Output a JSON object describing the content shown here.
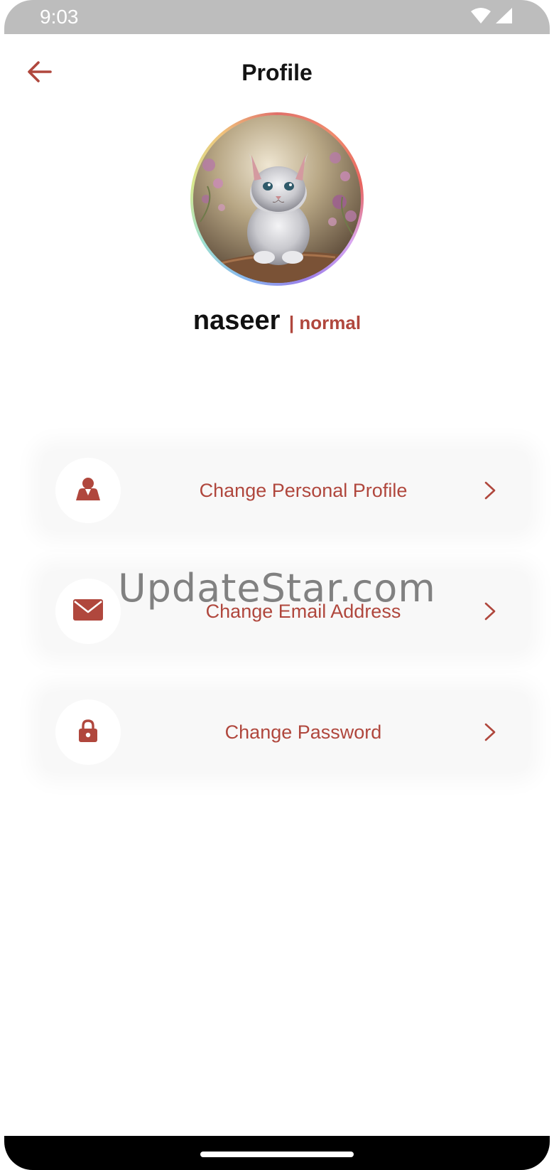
{
  "status_bar": {
    "time": "9:03",
    "icons": [
      "wifi-icon",
      "signal-icon"
    ]
  },
  "header": {
    "title": "Profile",
    "back_icon": "arrow-left-icon"
  },
  "profile": {
    "name": "naseer",
    "role": "| normal",
    "avatar": "kitten-photo"
  },
  "options": [
    {
      "label": "Change Personal Profile",
      "icon": "person-icon"
    },
    {
      "label": "Change Email Address",
      "icon": "mail-icon"
    },
    {
      "label": "Change Password",
      "icon": "lock-icon"
    }
  ],
  "watermark": "UpdateStar.com",
  "colors": {
    "accent": "#b0473d",
    "status_bar": "#bdbdbd",
    "card_bg": "#f8f8f8",
    "nav_bar": "#000000"
  }
}
